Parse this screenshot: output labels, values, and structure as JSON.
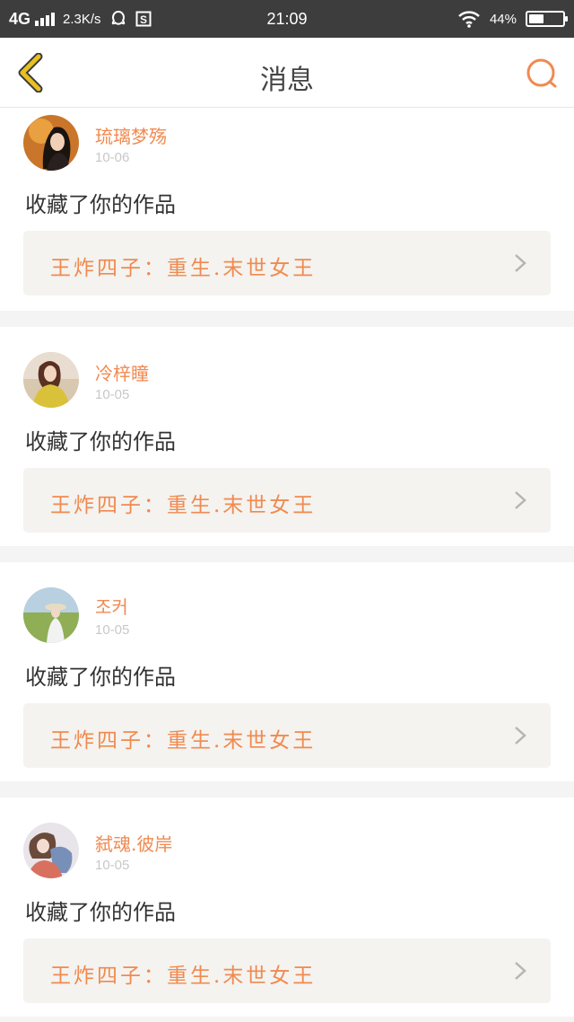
{
  "status_bar": {
    "network": "4G",
    "speed": "2.3K/s",
    "time": "21:09",
    "battery_text": "44%",
    "battery_level": 0.44
  },
  "header": {
    "title": "消息"
  },
  "messages": [
    {
      "username": "琉璃梦殇",
      "date": "10-06",
      "action": "收藏了你的作品",
      "work_title": "王炸四子：重生.末世女王"
    },
    {
      "username": "冷梓瞳",
      "date": "10-05",
      "action": "收藏了你的作品",
      "work_title": "王炸四子：重生.末世女王"
    },
    {
      "username": "조커",
      "date": "10-05",
      "action": "收藏了你的作品",
      "work_title": "王炸四子：重生.末世女王"
    },
    {
      "username": "弑魂.彼岸",
      "date": "10-05",
      "action": "收藏了你的作品",
      "work_title": "王炸四子：重生.末世女王"
    }
  ],
  "colors": {
    "accent": "#f08a50",
    "back_icon": "#e8c020",
    "status_bar_bg": "#3d3d3d"
  }
}
